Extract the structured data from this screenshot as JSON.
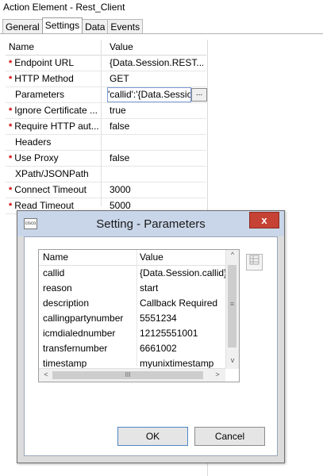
{
  "window": {
    "title": "Action Element - Rest_Client"
  },
  "tabs": [
    {
      "label": "General"
    },
    {
      "label": "Settings"
    },
    {
      "label": "Data"
    },
    {
      "label": "Events"
    }
  ],
  "properties": {
    "headers": {
      "name": "Name",
      "value": "Value"
    },
    "rows": [
      {
        "required": true,
        "name": "Endpoint URL",
        "value": "{Data.Session.REST..."
      },
      {
        "required": true,
        "name": "HTTP Method",
        "value": "GET"
      },
      {
        "required": false,
        "name": "Parameters",
        "value": "'callid':'{Data.Sessio"
      },
      {
        "required": true,
        "name": "Ignore Certificate ...",
        "value": "true"
      },
      {
        "required": true,
        "name": "Require HTTP aut...",
        "value": "false"
      },
      {
        "required": false,
        "name": "Headers",
        "value": ""
      },
      {
        "required": true,
        "name": "Use Proxy",
        "value": "false"
      },
      {
        "required": false,
        "name": "XPath/JSONPath",
        "value": ""
      },
      {
        "required": true,
        "name": "Connect Timeout",
        "value": "3000"
      },
      {
        "required": true,
        "name": "Read Timeout",
        "value": "5000"
      }
    ],
    "required_marker": "*",
    "ellipsis_label": "..."
  },
  "dialog": {
    "title": "Setting - Parameters",
    "logo_text": "cisco",
    "close_label": "x",
    "table": {
      "headers": {
        "name": "Name",
        "value": "Value"
      },
      "rows": [
        {
          "name": "callid",
          "value": "{Data.Session.callid}"
        },
        {
          "name": "reason",
          "value": "start"
        },
        {
          "name": "description",
          "value": "Callback Required"
        },
        {
          "name": "callingpartynumber",
          "value": "5551234"
        },
        {
          "name": "icmdialednumber",
          "value": "12125551001"
        },
        {
          "name": "transfernumber",
          "value": "6661002"
        },
        {
          "name": "timestamp",
          "value": "myunixtimestamp"
        }
      ]
    },
    "scroll": {
      "up": "^",
      "down": "v",
      "left": "<",
      "right": ">",
      "grip_v": "≡",
      "grip_h": "III"
    },
    "side_button_icon": "grid-icon",
    "ok_label": "OK",
    "cancel_label": "Cancel"
  },
  "colors": {
    "required_star": "#cc0000",
    "close_button": "#c54234",
    "dialog_title_bar": "#c9d6e9"
  }
}
